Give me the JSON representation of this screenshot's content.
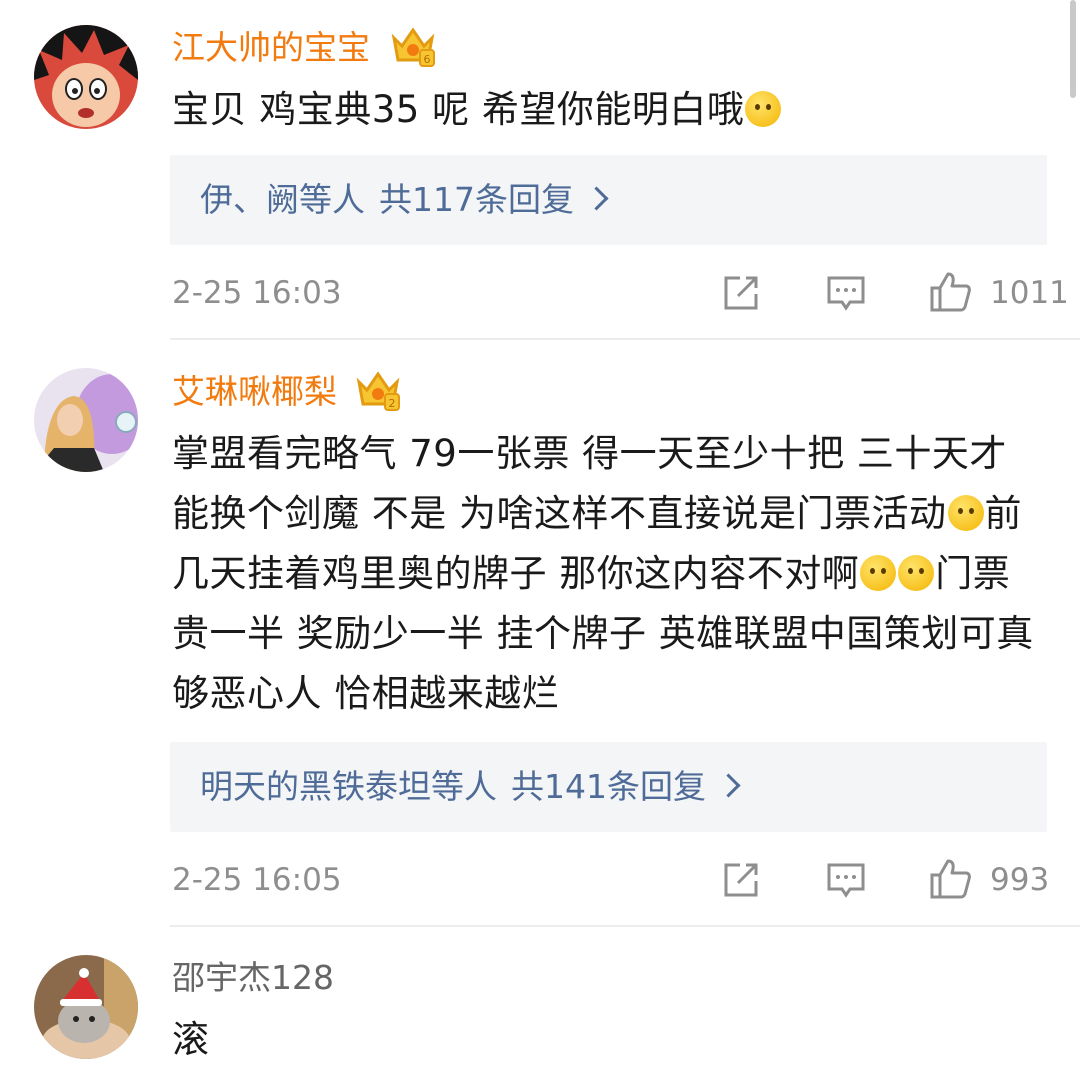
{
  "comments": [
    {
      "username": "江大帅的宝宝",
      "text_parts": [
        "宝贝 鸡宝典35 呢 希望你能明白哦"
      ],
      "reply_preview": {
        "names": "伊、阙等人",
        "count_label": "共117条回复"
      },
      "timestamp": "2-25 16:03",
      "likes": "1011"
    },
    {
      "username": "艾琳啾椰梨",
      "text_parts": [
        "掌盟看完略气 79一张票 得一天至少十把 三十天才能换个剑魔 不是 为啥这样不直接说是门票活动",
        "前几天挂着鸡里奥的牌子 那你这内容不对啊",
        "门票贵一半 奖励少一半 挂个牌子 英雄联盟中国策划可真够恶心人 恰相越来越烂"
      ],
      "reply_preview": {
        "names": "明天的黑铁泰坦等人",
        "count_label": "共141条回复"
      },
      "timestamp": "2-25 16:05",
      "likes": "993"
    },
    {
      "username": "邵宇杰128",
      "text_parts": [
        "滚"
      ]
    }
  ],
  "colors": {
    "vip_username": "#f27b10",
    "normal_username": "#666666",
    "link": "#4f6c98",
    "meta": "#8e8e8e",
    "reply_bg": "#f4f5f7"
  }
}
